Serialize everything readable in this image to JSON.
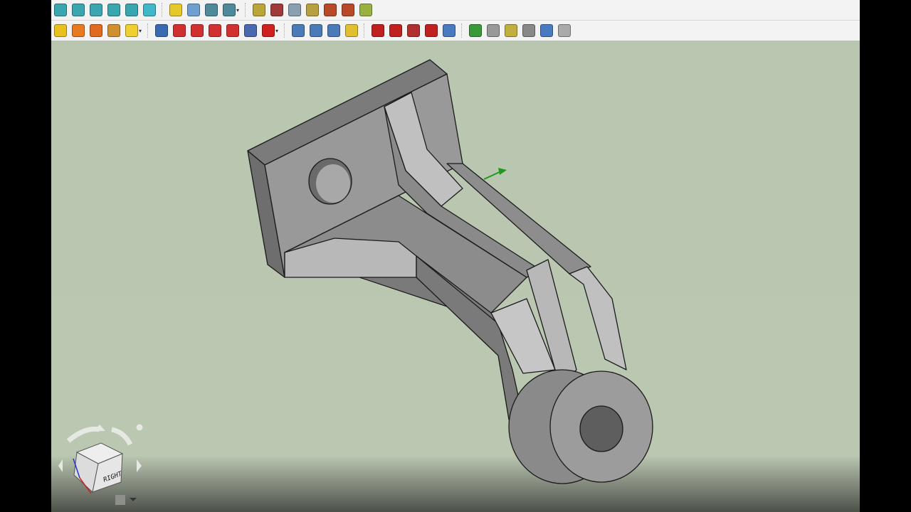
{
  "toolbar1": {
    "icons": [
      {
        "name": "view-front-icon",
        "color": "#39a6b0"
      },
      {
        "name": "view-top-icon",
        "color": "#39a6b0"
      },
      {
        "name": "view-right-icon",
        "color": "#39a6b0"
      },
      {
        "name": "view-rear-icon",
        "color": "#39a6b0"
      },
      {
        "name": "view-bottom-icon",
        "color": "#39a6b0"
      },
      {
        "name": "measure-icon",
        "color": "#3fb8c9"
      },
      {
        "name": "part-icon",
        "color": "#e6c82a"
      },
      {
        "name": "folder-icon",
        "color": "#6f9fd0"
      },
      {
        "name": "link-icon",
        "color": "#4f8a9a"
      },
      {
        "name": "link-dropdown-icon",
        "color": "#4f8a9a"
      },
      {
        "name": "select-icon",
        "color": "#b9a53a"
      },
      {
        "name": "deselect-icon",
        "color": "#a03a3a"
      },
      {
        "name": "select-all-icon",
        "color": "#8aa0b0"
      },
      {
        "name": "remove-icon",
        "color": "#b8a040"
      },
      {
        "name": "toggle-icon",
        "color": "#b84a2a"
      },
      {
        "name": "hide-icon",
        "color": "#b84a2a"
      },
      {
        "name": "show-icon",
        "color": "#9ab040"
      }
    ]
  },
  "toolbar2": {
    "icons": [
      {
        "name": "pad-icon",
        "color": "#e8c020"
      },
      {
        "name": "revolution-icon",
        "color": "#e87a20"
      },
      {
        "name": "additive-loft-icon",
        "color": "#e06a20"
      },
      {
        "name": "additive-pipe-icon",
        "color": "#d09030"
      },
      {
        "name": "additive-primitive-icon",
        "color": "#f0d030"
      },
      {
        "name": "pocket-icon",
        "color": "#3a6ab0"
      },
      {
        "name": "hole-icon",
        "color": "#d03030"
      },
      {
        "name": "groove-icon",
        "color": "#d03030"
      },
      {
        "name": "subtractive-loft-icon",
        "color": "#d03030"
      },
      {
        "name": "subtractive-pipe-icon",
        "color": "#d03030"
      },
      {
        "name": "subtractive-helix-icon",
        "color": "#4a6ab0"
      },
      {
        "name": "subtractive-primitive-icon",
        "color": "#d02020"
      },
      {
        "name": "mirrored-icon",
        "color": "#4a7ab8"
      },
      {
        "name": "linear-pattern-icon",
        "color": "#4a7ab8"
      },
      {
        "name": "polar-pattern-icon",
        "color": "#4a7ab8"
      },
      {
        "name": "multitransform-icon",
        "color": "#e0c030"
      },
      {
        "name": "fillet-icon",
        "color": "#c02020"
      },
      {
        "name": "chamfer-icon",
        "color": "#c02020"
      },
      {
        "name": "draft-icon",
        "color": "#b03030"
      },
      {
        "name": "thickness-icon",
        "color": "#c02020"
      },
      {
        "name": "boolean-icon",
        "color": "#4a7ac0"
      },
      {
        "name": "sprocket-icon",
        "color": "#3a9a3a"
      },
      {
        "name": "involute-gear-icon",
        "color": "#999999"
      },
      {
        "name": "shaft-icon",
        "color": "#c0b040"
      },
      {
        "name": "scatter-icon",
        "color": "#888888"
      },
      {
        "name": "datum-plane-icon",
        "color": "#4a7ac0"
      },
      {
        "name": "shape-binder-icon",
        "color": "#aaaaaa"
      }
    ]
  },
  "navcube": {
    "face_label": "RIGHT"
  },
  "colors": {
    "background": "#b9c6b0",
    "part": "#8e8e8e",
    "axis_green": "#1e9a1e"
  }
}
